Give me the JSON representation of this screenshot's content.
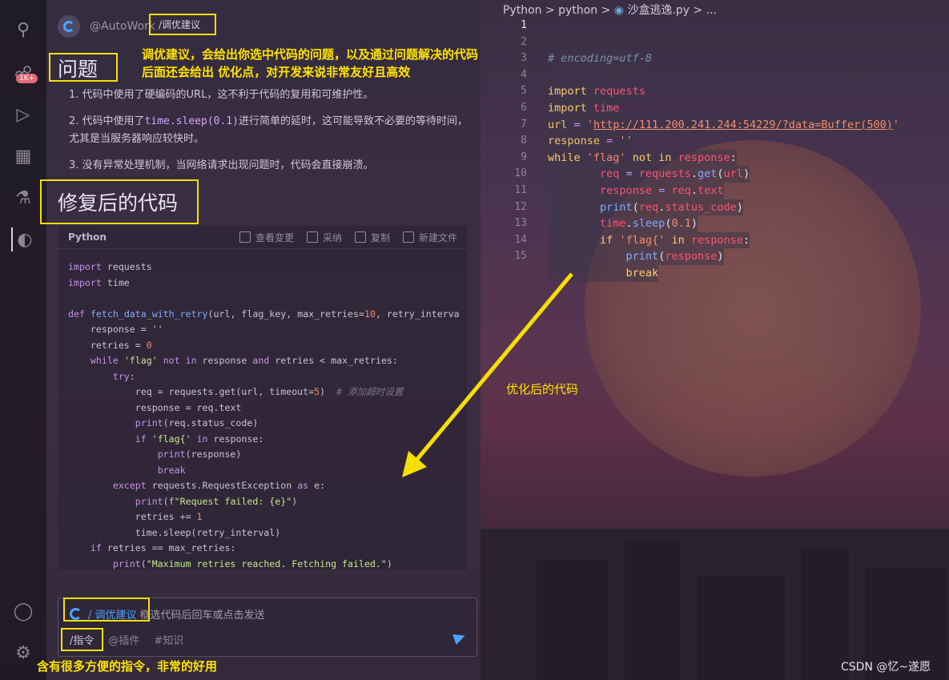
{
  "panel": {
    "user": "@AutoWork",
    "command_tag": "/调优建议",
    "heading_issues": "问题",
    "heading_fixed": "修复后的代码",
    "issues": [
      {
        "prefix": "1. 代码中使用了硬编码的URL，这不利于代码的复用和可维护性。",
        "code": "",
        "suffix": ""
      },
      {
        "prefix": "2. 代码中使用了",
        "code": "time.sleep(0.1)",
        "suffix": "进行简单的延时，这可能导致不必要的等待时间，尤其是当服务器响应较快时。"
      },
      {
        "prefix": "3. 没有异常处理机制，当网络请求出现问题时，代码会直接崩溃。",
        "code": "",
        "suffix": ""
      }
    ],
    "code_block": {
      "language": "Python",
      "actions": [
        "查看变更",
        "采纳",
        "复制",
        "新建文件"
      ]
    },
    "input": {
      "tag": "/ 调优建议",
      "placeholder": "框选代码后回车或点击发送",
      "tools": [
        "/指令",
        "@插件",
        "#知识"
      ]
    }
  },
  "annotations": {
    "top_line1": "调优建议，会给出你选中代码的问题，以及通过问题解决的代码",
    "top_line2": "后面还会给出 优化点，对开发来说非常友好且高效",
    "arrow_label": "优化后的代码",
    "bottom": "含有很多方便的指令，非常的好用"
  },
  "editor": {
    "breadcrumb": [
      "Python",
      "python",
      "沙盒逃逸.py",
      "..."
    ],
    "line_numbers": [
      "1",
      "2",
      "3",
      "4",
      "5",
      "6",
      "7",
      "8",
      "9",
      "10",
      "11",
      "12",
      "13",
      "14",
      "15"
    ]
  },
  "activity": {
    "badge": "1K+"
  },
  "watermark": "CSDN @忆~遂愿",
  "colors": {
    "annotation": "#f7e000",
    "accent": "#4aa3ff"
  }
}
